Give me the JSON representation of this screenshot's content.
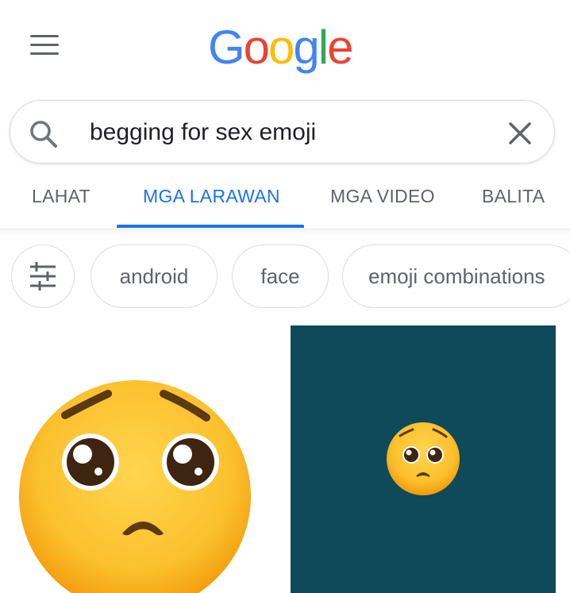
{
  "header": {
    "logo_letters": [
      {
        "char": "G",
        "color": "#4285F4"
      },
      {
        "char": "o",
        "color": "#EA4335"
      },
      {
        "char": "o",
        "color": "#FBBC05"
      },
      {
        "char": "g",
        "color": "#4285F4"
      },
      {
        "char": "l",
        "color": "#34A853"
      },
      {
        "char": "e",
        "color": "#EA4335"
      }
    ],
    "menu_icon": "hamburger-menu-icon"
  },
  "search": {
    "query": "begging for sex emoji",
    "search_icon": "search-icon",
    "clear_icon": "close-icon"
  },
  "tabs": [
    {
      "label": "LAHAT",
      "active": false
    },
    {
      "label": "MGA LARAWAN",
      "active": true
    },
    {
      "label": "MGA VIDEO",
      "active": false
    },
    {
      "label": "BALITA",
      "active": false
    }
  ],
  "chips": {
    "filter_icon": "tune-icon",
    "items": [
      "android",
      "face",
      "emoji combinations"
    ]
  },
  "results": [
    {
      "emoji": "pleading-face",
      "background": "#ffffff"
    },
    {
      "emoji": "pleading-face",
      "background": "#0e4a5a"
    }
  ],
  "colors": {
    "accent": "#1a73e8",
    "emoji_yellow": "#fbc02d"
  }
}
